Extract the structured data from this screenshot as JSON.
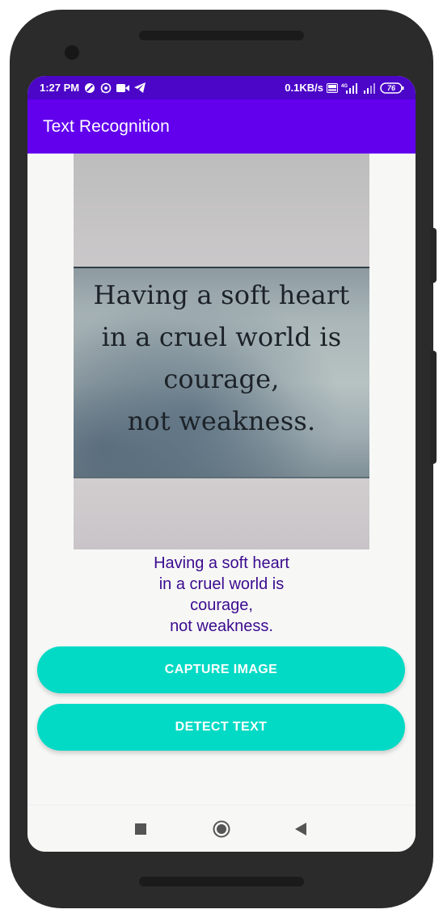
{
  "status_bar": {
    "time": "1:27 PM",
    "network_speed": "0.1KB/s",
    "battery": "76",
    "icons": [
      "do-not-disturb-icon",
      "whatsapp-icon",
      "video-camera-icon",
      "telegram-icon",
      "volte-icon",
      "signal-icon",
      "signal-icon-2",
      "battery-icon"
    ]
  },
  "app_bar": {
    "title": "Text Recognition"
  },
  "photo": {
    "lines": [
      "Having a soft heart",
      "in a cruel world is",
      "courage,",
      "not weakness."
    ]
  },
  "recognized_text": {
    "lines": [
      "Having a soft heart",
      "in a cruel world is",
      "courage,",
      "not weakness."
    ]
  },
  "buttons": {
    "capture_label": "CAPTURE IMAGE",
    "detect_label": "DETECT TEXT"
  },
  "colors": {
    "status_bar": "#4b06c8",
    "app_bar": "#6200ee",
    "button": "#03dac5",
    "result_text": "#3b0a8f"
  },
  "nav_bar": {
    "icons": [
      "recents-icon",
      "home-icon",
      "back-icon"
    ]
  }
}
